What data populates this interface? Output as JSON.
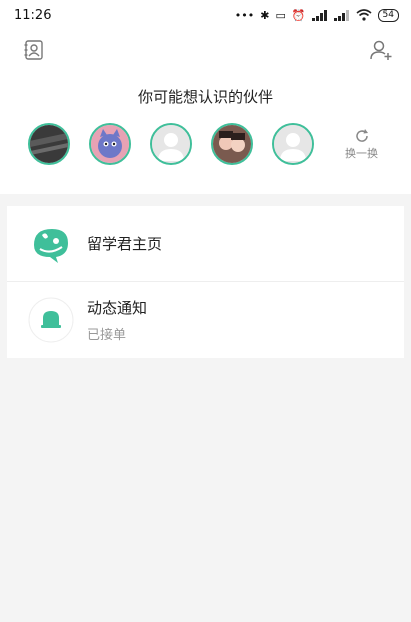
{
  "status": {
    "time": "11:26",
    "battery": "54"
  },
  "suggest": {
    "title": "你可能想认识的伙伴",
    "refresh_label": "换一换",
    "avatars": [
      "photo-dark",
      "cartoon-cat",
      "default",
      "photo-couple",
      "default"
    ]
  },
  "list": [
    {
      "title": "留学君主页",
      "subtitle": ""
    },
    {
      "title": "动态通知",
      "subtitle": "已接单"
    }
  ],
  "colors": {
    "accent": "#3fbf9a",
    "background": "#f4f4f4"
  }
}
